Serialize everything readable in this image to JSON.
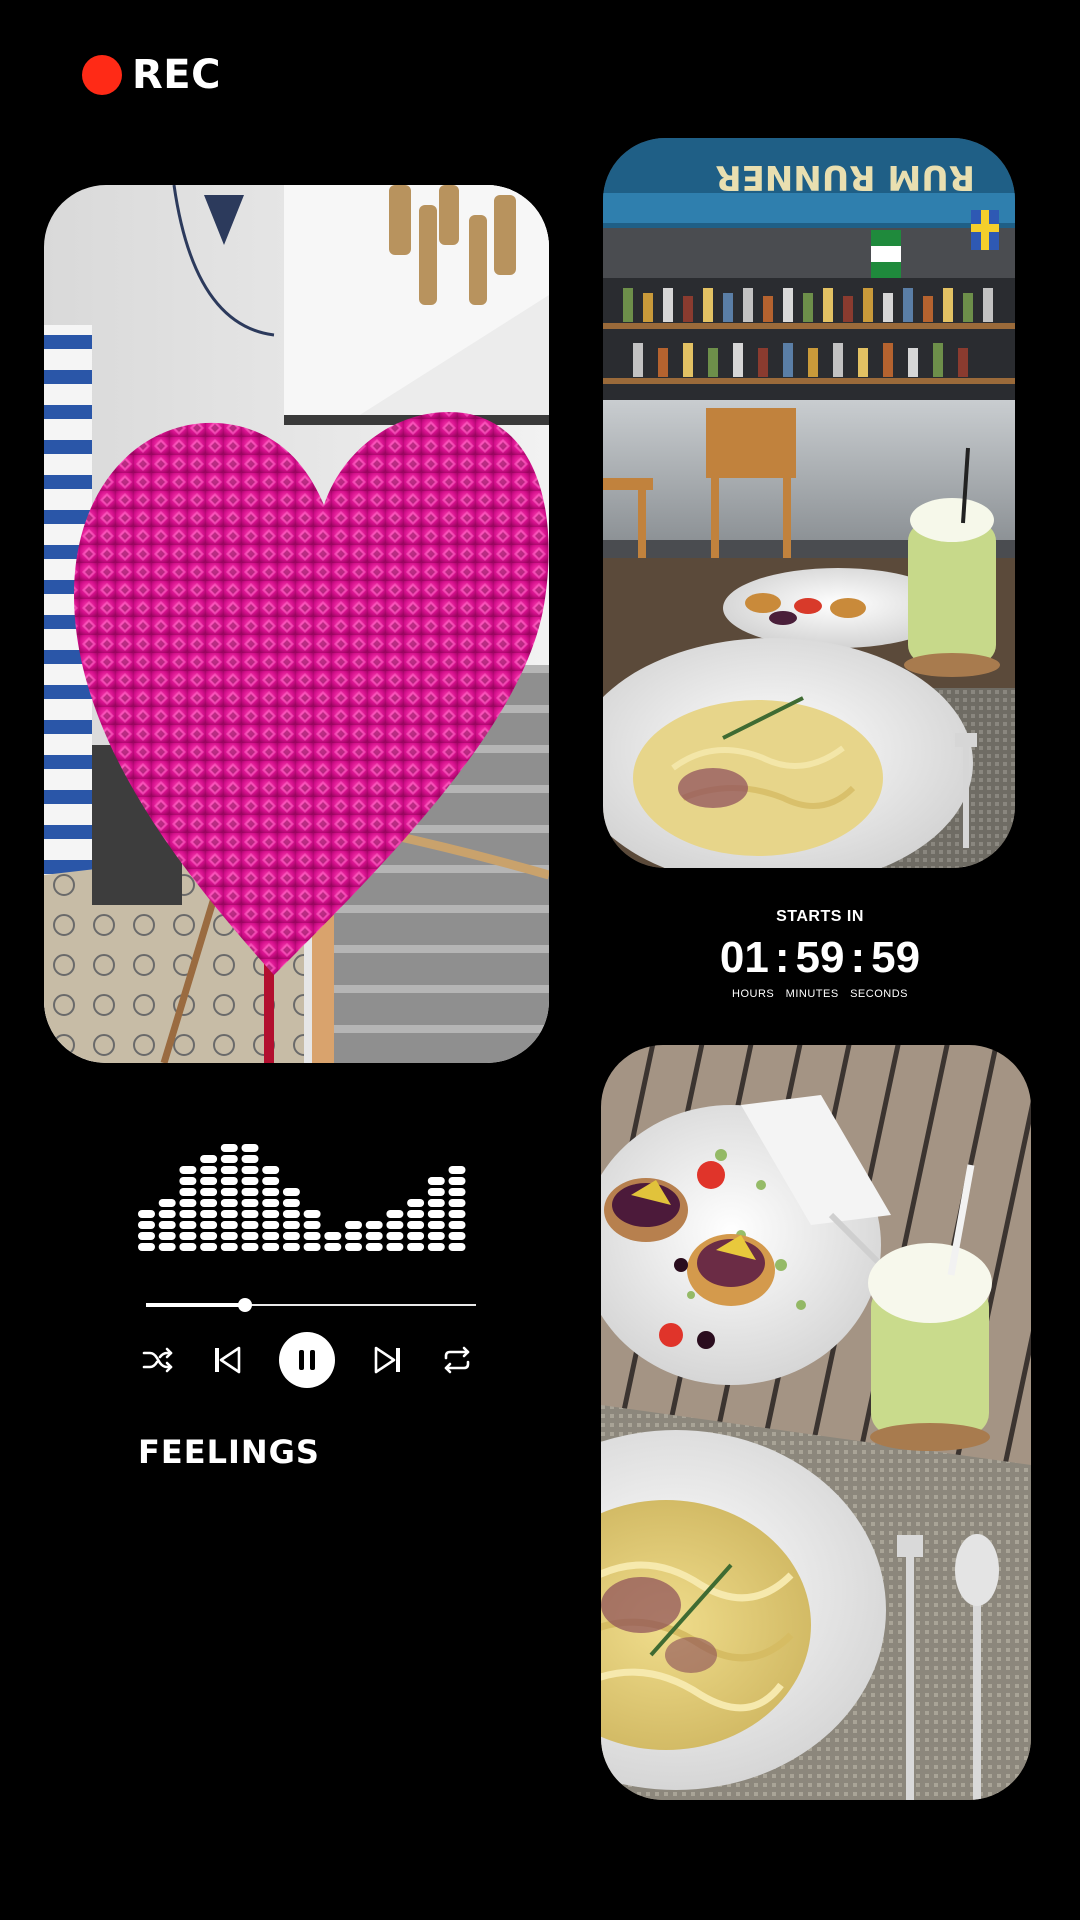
{
  "recording": {
    "label": "REC",
    "dot_color": "#ff2a16"
  },
  "photos": [
    {
      "name": "heart-photo",
      "icon": "pink-foil-heart-on-stand"
    },
    {
      "name": "bar-photo",
      "icon": "bar-counter-with-pasta-and-drink"
    },
    {
      "name": "food-photo",
      "icon": "carbonara-tartlets-and-green-drink"
    }
  ],
  "countdown": {
    "caption": "STARTS IN",
    "hours": "01",
    "minutes": "59",
    "seconds": "59",
    "separator": ":",
    "hours_label": "HOURS",
    "minutes_label": "MINUTES",
    "seconds_label": "SECONDS"
  },
  "player": {
    "song_title": "FEELINGS",
    "progress": 0.3,
    "equalizer_levels": [
      3,
      4,
      7,
      8,
      9,
      9,
      7,
      5,
      3,
      1,
      2,
      2,
      3,
      4,
      6,
      7
    ],
    "controls": [
      "shuffle-icon",
      "previous-icon",
      "pause-icon",
      "next-icon",
      "repeat-icon"
    ]
  }
}
